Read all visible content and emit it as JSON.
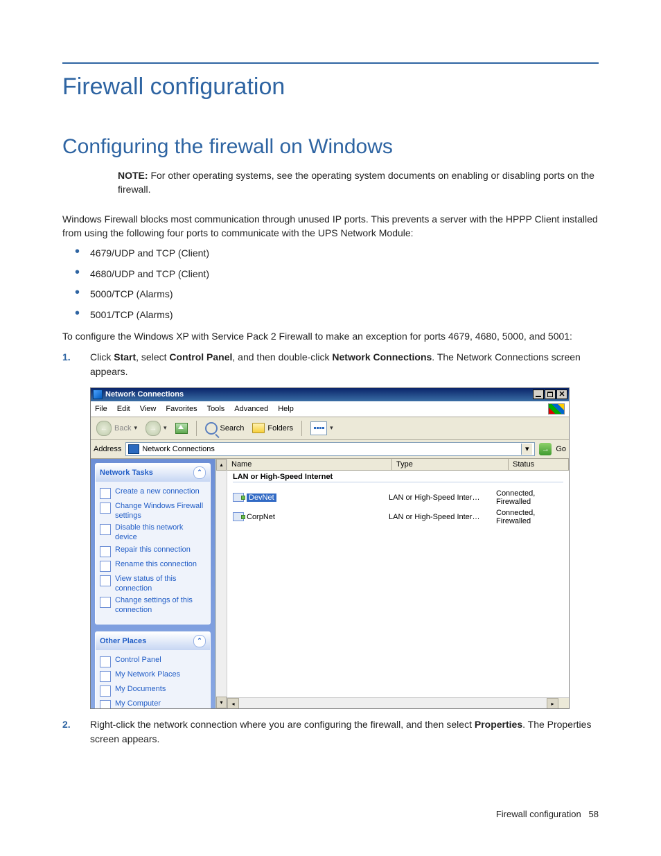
{
  "headings": {
    "h1": "Firewall configuration",
    "h2": "Configuring the firewall on Windows"
  },
  "note": {
    "label": "NOTE:",
    "text": " For other operating systems, see the operating system documents on enabling or disabling ports on the firewall."
  },
  "intro": "Windows Firewall blocks most communication through unused IP ports. This prevents a server with the HPPP Client installed from using the following four ports to communicate with the UPS Network Module:",
  "bullets": [
    "4679/UDP and TCP (Client)",
    "4680/UDP and TCP (Client)",
    "5000/TCP (Alarms)",
    "5001/TCP (Alarms)"
  ],
  "lead2": "To configure the Windows XP with Service Pack 2 Firewall to make an exception for ports 4679, 4680, 5000, and 5001:",
  "steps": [
    {
      "num": "1.",
      "pre": "Click ",
      "b1": "Start",
      "mid1": ", select ",
      "b2": "Control Panel",
      "mid2": ", and then double-click ",
      "b3": "Network Connections",
      "post": ". The Network Connections screen appears."
    },
    {
      "num": "2.",
      "pre": "Right-click the network connection where you are configuring the firewall, and then select ",
      "b1": "Properties",
      "mid1": ". The Properties screen appears.",
      "b2": "",
      "mid2": "",
      "b3": "",
      "post": ""
    }
  ],
  "footer": {
    "text": "Firewall configuration",
    "page": "58"
  },
  "screenshot": {
    "title": "Network Connections",
    "menu": [
      "File",
      "Edit",
      "View",
      "Favorites",
      "Tools",
      "Advanced",
      "Help"
    ],
    "toolbar": {
      "back": "Back",
      "search": "Search",
      "folders": "Folders"
    },
    "address": {
      "label": "Address",
      "value": "Network Connections",
      "go": "Go"
    },
    "tasks": {
      "head1": "Network Tasks",
      "items1": [
        "Create a new connection",
        "Change Windows Firewall settings",
        "Disable this network device",
        "Repair this connection",
        "Rename this connection",
        "View status of this connection",
        "Change settings of this connection"
      ],
      "head2": "Other Places",
      "items2": [
        "Control Panel",
        "My Network Places",
        "My Documents",
        "My Computer"
      ]
    },
    "columns": {
      "name": "Name",
      "type": "Type",
      "status": "Status"
    },
    "group": "LAN or High-Speed Internet",
    "rows": [
      {
        "name": "DevNet",
        "type": "LAN or High-Speed Inter…",
        "status": "Connected, Firewalled",
        "selected": true
      },
      {
        "name": "CorpNet",
        "type": "LAN or High-Speed Inter…",
        "status": "Connected, Firewalled",
        "selected": false
      }
    ]
  }
}
